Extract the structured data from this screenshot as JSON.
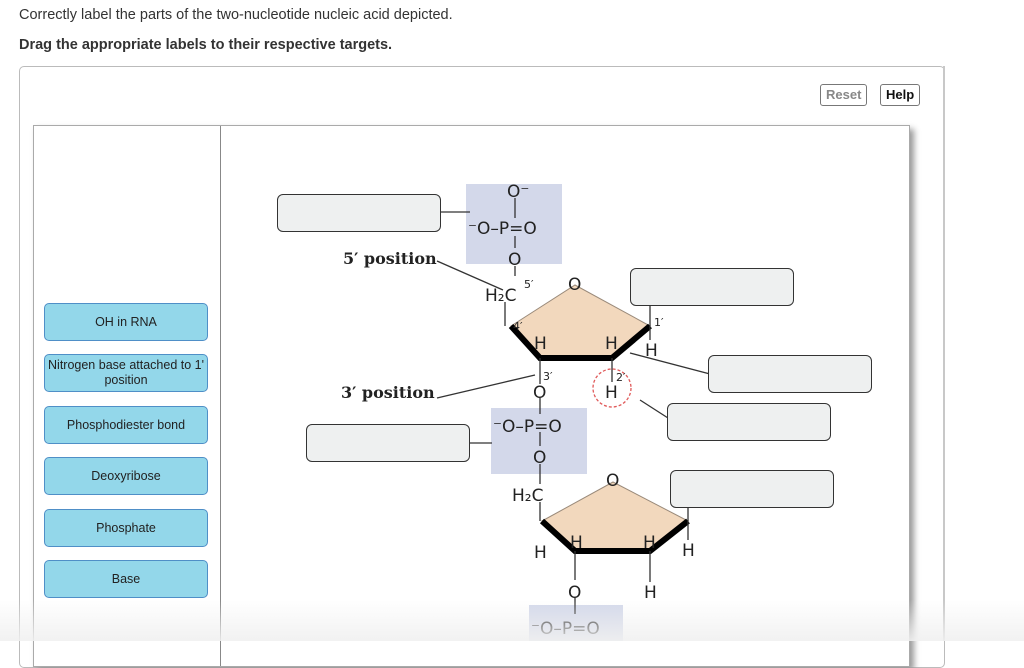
{
  "instructions": {
    "line1": "Correctly label the parts of the two-nucleotide nucleic acid depicted.",
    "line2": "Drag the appropriate labels to their respective targets."
  },
  "toolbar": {
    "reset_label": "Reset",
    "help_label": "Help"
  },
  "label_bank": [
    {
      "label": "OH in RNA"
    },
    {
      "label": "Nitrogen base attached to 1' position"
    },
    {
      "label": "Phosphodiester bond"
    },
    {
      "label": "Deoxyribose"
    },
    {
      "label": "Phosphate"
    },
    {
      "label": "Base"
    }
  ],
  "diagram": {
    "five_prime_label": "5′ position",
    "three_prime_label": "3′ position",
    "atoms": {
      "o_minus": "O⁻",
      "p_line": "⁻O–P=O",
      "o": "O",
      "h2c": "H₂C",
      "h": "H",
      "c5": "5′",
      "c4": "4′",
      "c3": "3′",
      "c2": "2′",
      "c1": "1′"
    },
    "colors": {
      "phosphate_bg": "#d3d8ea",
      "sugar_fill": "#f2d8bd",
      "rna_highlight": "#e05a5a",
      "chip_bg": "#93d7ea",
      "chip_border": "#4f8fc7"
    }
  },
  "drop_targets": [
    {
      "id": "target-phosphate-top"
    },
    {
      "id": "target-base-1prime"
    },
    {
      "id": "target-bond-2prime"
    },
    {
      "id": "target-oh-rna"
    },
    {
      "id": "target-phosphodiester"
    },
    {
      "id": "target-base-2nd"
    }
  ]
}
